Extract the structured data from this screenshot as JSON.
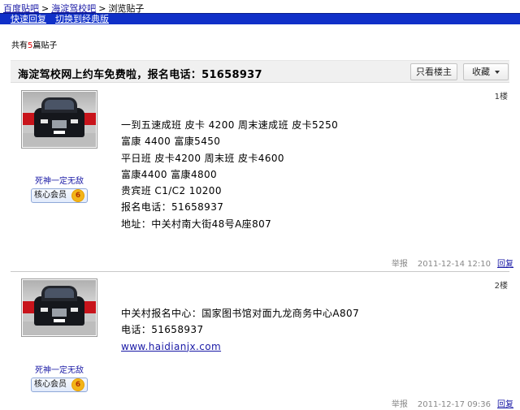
{
  "breadcrumb": {
    "items": [
      "百度贴吧",
      "海淀驾校吧"
    ],
    "current": "浏览贴子",
    "separator": ">"
  },
  "toolbar": {
    "quick_reply": "快速回复",
    "classic": "切换到经典版"
  },
  "thread": {
    "count_prefix": "共有",
    "count": "5",
    "count_suffix": "篇贴子",
    "title": "海淀驾校网上约车免费啦，报名电话：51658937",
    "only_author": "只看楼主",
    "favorite": "收藏"
  },
  "posts": [
    {
      "floor": "1楼",
      "username": "死神一定无敌",
      "badge": "核心会员",
      "level": "6",
      "lines": [
        "一到五速成班 皮卡 4200 周末速成班 皮卡5250",
        "富康 4400 富康5450",
        "平日班 皮卡4200 周末班 皮卡4600",
        "富康4400 富康4800",
        "贵宾班 C1/C2 10200",
        "报名电话：51658937",
        "地址：中关村南大街48号A座807"
      ],
      "report": "举报",
      "time": "2011-12-14 12:10",
      "reply": "回复"
    },
    {
      "floor": "2楼",
      "username": "死神一定无敌",
      "badge": "核心会员",
      "level": "6",
      "lines": [
        "中关村报名中心：国家图书馆对面九龙商务中心A807",
        "电话：51658937"
      ],
      "link": "www.haidianjx.com",
      "report": "举报",
      "time": "2011-12-17 09:36",
      "reply": "回复"
    }
  ],
  "colors": {
    "bar": "#1030c8",
    "link": "#1a1aa6",
    "count_highlight": "#e00000"
  }
}
